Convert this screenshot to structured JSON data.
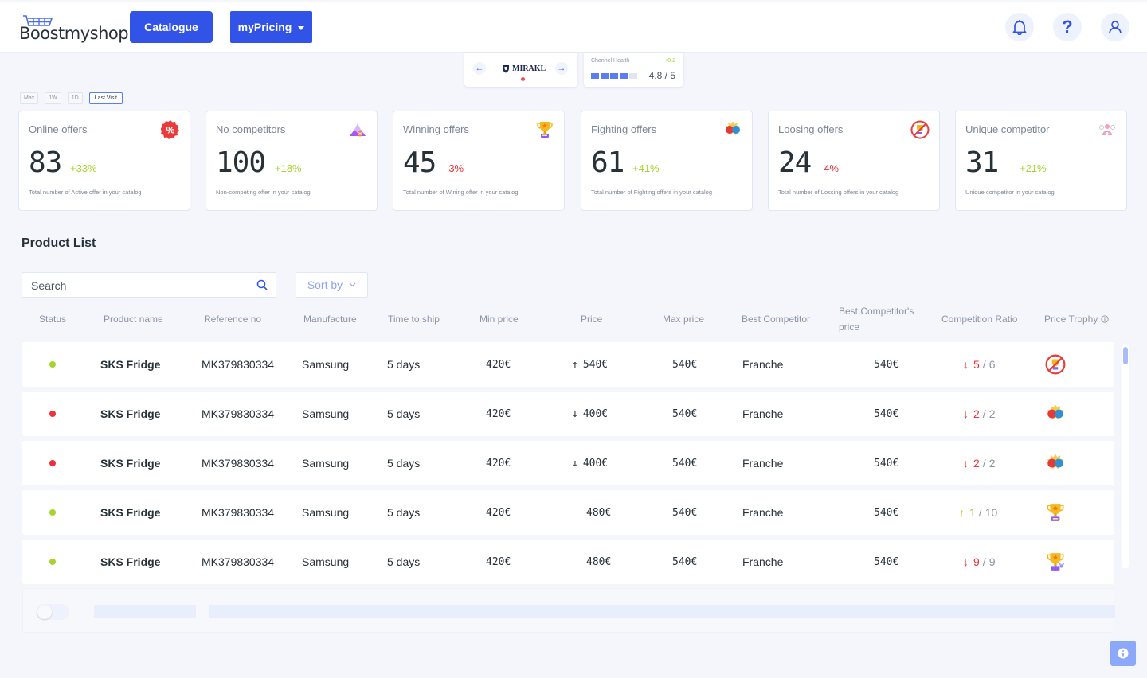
{
  "header": {
    "logo": "Boostmyshop",
    "nav": [
      {
        "label": "Catalogue"
      },
      {
        "label": "myPricing"
      }
    ],
    "icons": [
      "bell-icon",
      "help-icon",
      "user-icon"
    ]
  },
  "channel": {
    "name": "MIRAKL",
    "health_label": "Channel Health",
    "health_delta": "+0.2",
    "health_score": "4.8 / 5",
    "health_value": 4.8,
    "health_max": 5
  },
  "ranges": [
    "Max",
    "1W",
    "1D",
    "Last Visit"
  ],
  "active_range": "Last Visit",
  "kpis": [
    {
      "title": "Online offers",
      "value": "83",
      "delta": "+33%",
      "trend": "pos",
      "desc": "Total number of Active offer in your catalog",
      "icon": "percent-badge-icon"
    },
    {
      "title": "No competitors",
      "value": "100",
      "delta": "+18%",
      "trend": "pos",
      "desc": "Non-competing offer in your catalog",
      "icon": "no-competitor-icon"
    },
    {
      "title": "Winning offers",
      "value": "45",
      "delta": "-3%",
      "trend": "neg",
      "desc": "Total number of Wining offer in your catalog",
      "icon": "trophy-icon"
    },
    {
      "title": "Fighting offers",
      "value": "61",
      "delta": "+41%",
      "trend": "pos",
      "desc": "Total number of Fighting offers in your catalog",
      "icon": "boxing-gloves-icon"
    },
    {
      "title": "Loosing offers",
      "value": "24",
      "delta": "-4%",
      "trend": "neg",
      "desc": "Total number of Lossing offers in your catalog",
      "icon": "no-trophy-icon"
    },
    {
      "title": "Unique competitor",
      "value": "31",
      "delta": "+21%",
      "trend": "pos",
      "desc": "Unique competitor in your catalog",
      "icon": "unique-competitor-icon"
    }
  ],
  "product_list": {
    "title": "Product List",
    "search_placeholder": "Search",
    "sort_label": "Sort by",
    "columns": [
      "Status",
      "Product name",
      "Reference no",
      "Manufacture",
      "Time to ship",
      "Min price",
      "Price",
      "Max price",
      "Best Competitor",
      "Best Competitor's price",
      "Competition Ratio",
      "Price Trophy"
    ],
    "rows": [
      {
        "status": "active",
        "status_color": "#a5d42a",
        "name": "SKS Fridge",
        "ref": "MK379830334",
        "manufacture": "Samsung",
        "ship": "5 days",
        "min": "420€",
        "price": "540€",
        "price_trend": "up",
        "max": "540€",
        "competitor": "Franche",
        "competitor_price": "540€",
        "rank": "5",
        "rank_total": "6",
        "rank_trend": "down",
        "trophy": "no-trophy-icon"
      },
      {
        "status": "inactive",
        "status_color": "#f0303a",
        "name": "SKS Fridge",
        "ref": "MK379830334",
        "manufacture": "Samsung",
        "ship": "5 days",
        "min": "420€",
        "price": "400€",
        "price_trend": "down",
        "max": "540€",
        "competitor": "Franche",
        "competitor_price": "540€",
        "rank": "2",
        "rank_total": "2",
        "rank_trend": "down",
        "trophy": "boxing-gloves-icon"
      },
      {
        "status": "inactive",
        "status_color": "#f0303a",
        "name": "SKS Fridge",
        "ref": "MK379830334",
        "manufacture": "Samsung",
        "ship": "5 days",
        "min": "420€",
        "price": "400€",
        "price_trend": "down",
        "max": "540€",
        "competitor": "Franche",
        "competitor_price": "540€",
        "rank": "2",
        "rank_total": "2",
        "rank_trend": "down",
        "trophy": "boxing-gloves-icon"
      },
      {
        "status": "active",
        "status_color": "#a5d42a",
        "name": "SKS Fridge",
        "ref": "MK379830334",
        "manufacture": "Samsung",
        "ship": "5 days",
        "min": "420€",
        "price": "480€",
        "price_trend": "none",
        "max": "540€",
        "competitor": "Franche",
        "competitor_price": "540€",
        "rank": "1",
        "rank_total": "10",
        "rank_trend": "up",
        "trophy": "trophy-icon"
      },
      {
        "status": "active",
        "status_color": "#a5d42a",
        "name": "SKS Fridge",
        "ref": "MK379830334",
        "manufacture": "Samsung",
        "ship": "5 days",
        "min": "420€",
        "price": "480€",
        "price_trend": "none",
        "max": "540€",
        "competitor": "Franche",
        "competitor_price": "540€",
        "rank": "9",
        "rank_total": "9",
        "rank_trend": "down",
        "trophy": "trophy-paw-icon"
      }
    ]
  },
  "colors": {
    "accent": "#3153e8",
    "positive": "#a5d42a",
    "negative": "#f0303a"
  }
}
